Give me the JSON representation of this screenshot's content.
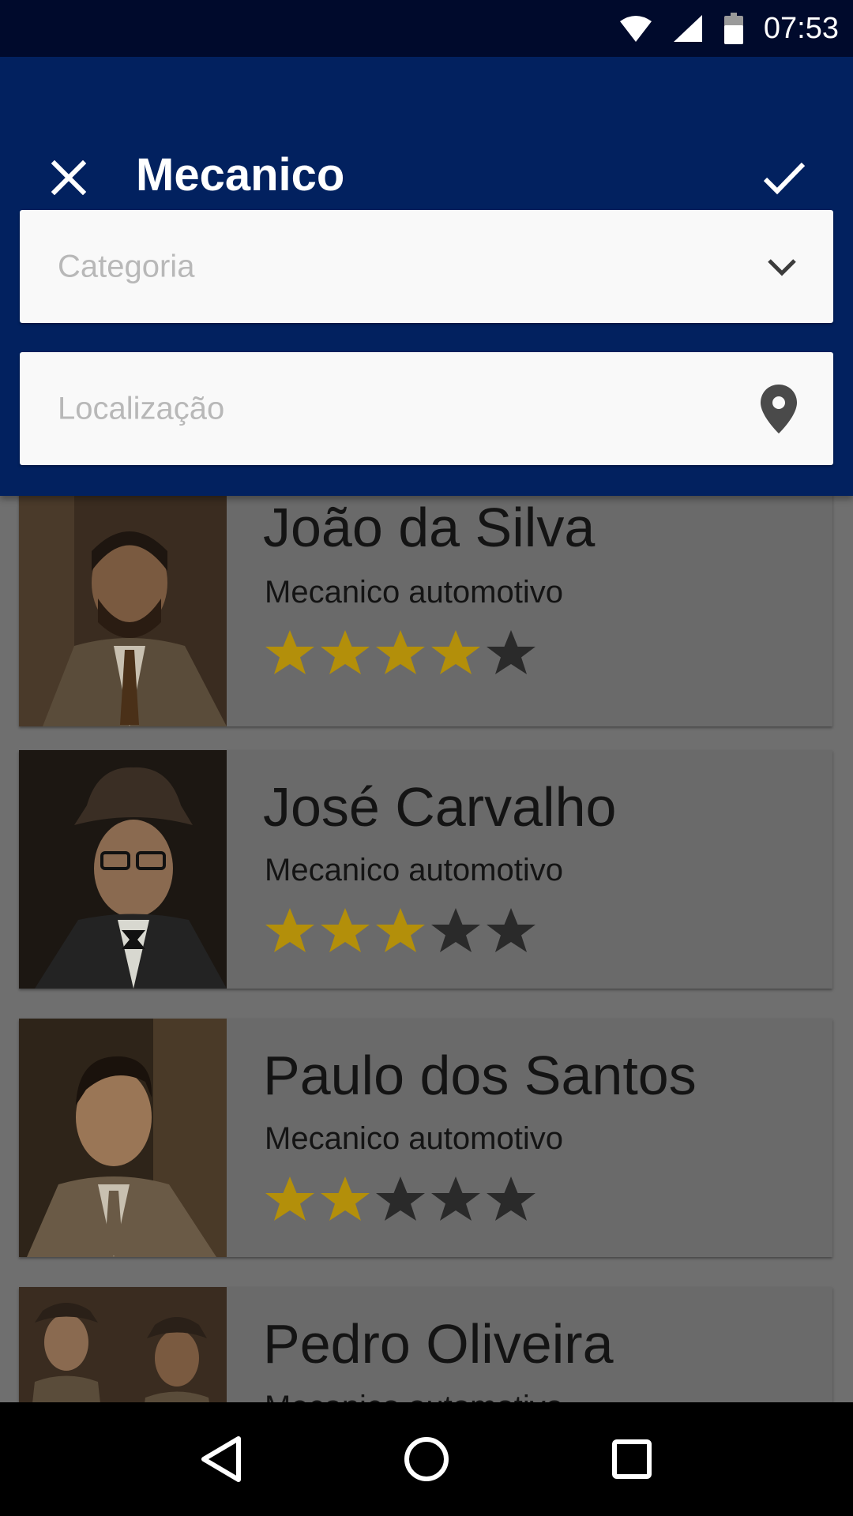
{
  "status_bar": {
    "time": "07:53",
    "icons": [
      "wifi-icon",
      "signal-icon",
      "battery-icon"
    ]
  },
  "app_bar": {
    "title": "Mecanico",
    "close_icon": "close-icon",
    "confirm_icon": "check-icon"
  },
  "filters": {
    "category": {
      "placeholder": "Categoria",
      "icon": "chevron-down-icon"
    },
    "location": {
      "placeholder": "Localização",
      "icon": "location-pin-icon"
    }
  },
  "results": [
    {
      "name": "João da Silva",
      "role": "Mecanico automotivo",
      "rating": 4,
      "max_rating": 5
    },
    {
      "name": "José Carvalho",
      "role": "Mecanico automotivo",
      "rating": 3,
      "max_rating": 5
    },
    {
      "name": "Paulo dos Santos",
      "role": "Mecanico automotivo",
      "rating": 2,
      "max_rating": 5
    },
    {
      "name": "Pedro Oliveira",
      "role": "Mecanico automotivo",
      "rating": null,
      "max_rating": 5
    }
  ],
  "colors": {
    "status_bar": "#000a2c",
    "app_bar": "#02215f",
    "overlay_background": "#6f6f6f",
    "star_filled": "#b38f0a",
    "star_empty": "#2a2a2a"
  },
  "nav_bar": {
    "icons": [
      "back-icon",
      "home-icon",
      "recents-icon"
    ]
  }
}
